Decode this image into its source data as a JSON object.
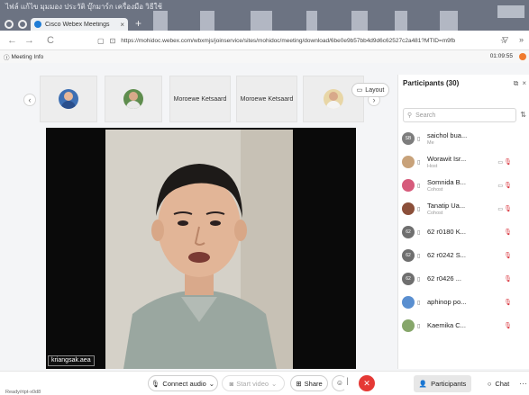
{
  "tabstrip": {
    "top_text": "ไฟล์ แก้ไข มุมมอง ประวัติ บุ๊กมาร์ก เครื่องมือ วิธีใช้",
    "tab_title": "Cisco Webex Meetings",
    "tab_close": "×",
    "new_tab": "+"
  },
  "browser": {
    "back": "←",
    "forward": "→",
    "reload": "C",
    "url": "https://mohidoc.webex.com/wbxmjs/joinservice/sites/mohidoc/meeting/download/6be0e9b57bb4d9d6c62527c2a481?MTID=m9fb",
    "bookmark_icon": "☆",
    "shield": "▢",
    "lock": "🔒"
  },
  "meeting": {
    "info_label": "Meeting Info",
    "timer": "01:09:55",
    "layout_label": "Layout",
    "name_tag": "kriangsak.aea",
    "status": "Ready/rtpt-x0d8"
  },
  "filmstrip": {
    "tiles": [
      {
        "name": ""
      },
      {
        "name": ""
      },
      {
        "name": "Moroewe Ketsaard"
      },
      {
        "name": "Moroewe Ketsaard"
      },
      {
        "name": ""
      }
    ]
  },
  "participants": {
    "title": "Participants (30)",
    "search_placeholder": "Search",
    "list": [
      {
        "initials": "SB",
        "name": "saichol bua...",
        "role": "Me",
        "color": "#7d7d7d",
        "cam": "",
        "mic": ""
      },
      {
        "initials": "",
        "name": "Worawit Isr...",
        "role": "Host",
        "color": "#c8a27a",
        "cam": "▭",
        "mic": "🎙"
      },
      {
        "initials": "",
        "name": "Somnida B...",
        "role": "Cohost",
        "color": "#d65b7b",
        "cam": "▭",
        "mic": "🎙"
      },
      {
        "initials": "",
        "name": "Tanatip Ua...",
        "role": "Cohost",
        "color": "#8b4f3a",
        "cam": "▭",
        "mic": "🎙"
      },
      {
        "initials": "62",
        "name": "62 r0180 K...",
        "role": "",
        "color": "#6f6f6f",
        "cam": "",
        "mic": "🎙"
      },
      {
        "initials": "62",
        "name": "62 r0242 S...",
        "role": "",
        "color": "#6f6f6f",
        "cam": "",
        "mic": "🎙"
      },
      {
        "initials": "62",
        "name": "62 r0426 ...",
        "role": "",
        "color": "#6f6f6f",
        "cam": "",
        "mic": "🎙"
      },
      {
        "initials": "",
        "name": "aphinop po...",
        "role": "",
        "color": "#5a8fd0",
        "cam": "",
        "mic": "🎙"
      },
      {
        "initials": "",
        "name": "Kaemika C...",
        "role": "",
        "color": "#86a66a",
        "cam": "",
        "mic": "🎙"
      }
    ]
  },
  "toolbar": {
    "connect_audio": "Connect audio",
    "start_video": "Start video",
    "share": "Share",
    "participants": "Participants",
    "chat": "Chat",
    "more": "···"
  },
  "colors": {
    "tabstrip_bg": "#6c7382",
    "end_button": "#e53935",
    "mic_muted": "#d9363e",
    "recording_dot": "#f07b2f"
  }
}
